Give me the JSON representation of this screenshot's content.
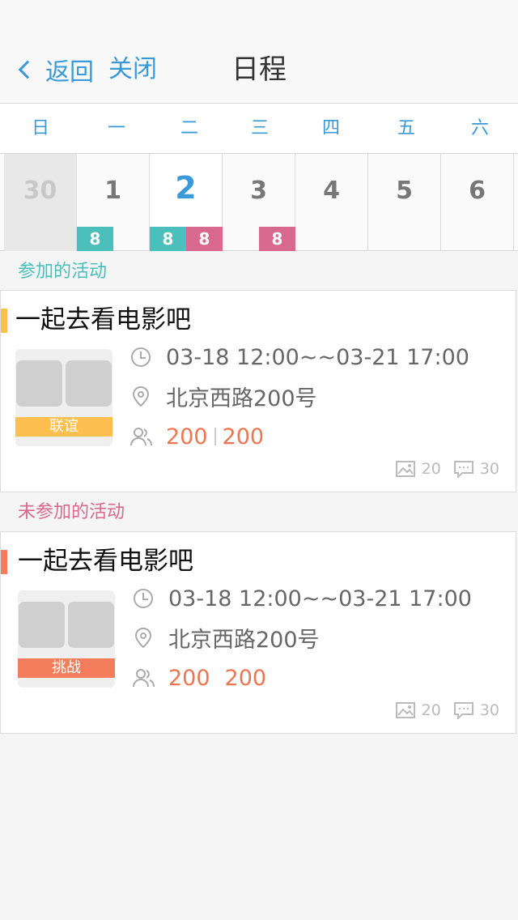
{
  "nav": {
    "back_label": "返回",
    "close_label": "关闭",
    "title": "日程"
  },
  "calendar": {
    "weekdays": [
      "日",
      "一",
      "二",
      "三",
      "四",
      "五",
      "六"
    ],
    "days": [
      "30",
      "1",
      "2",
      "3",
      "4",
      "5",
      "6"
    ],
    "badges": {
      "mon_teal": "8",
      "tue_teal": "8",
      "tue_pink": "8",
      "wed_pink": "8"
    },
    "colors": {
      "teal": "#4bbfbb",
      "pink": "#d9688f",
      "accent": "#3a9ad9"
    }
  },
  "sections": {
    "joined_title": "参加的活动",
    "unjoined_title": "未参加的活动"
  },
  "joined": {
    "title": "一起去看电影吧",
    "tag": "联谊",
    "tag_color": "#ffbf50",
    "time": "03-18  12:00~~03-21  17:00",
    "location": "北京西路200号",
    "count_current": "200",
    "count_max": "200",
    "photos": "20",
    "comments": "30"
  },
  "unjoined": {
    "title": "一起去看电影吧",
    "tag": "挑战",
    "tag_color": "#f47d5d",
    "time": "03-18  12:00~~03-21  17:00",
    "location": "北京西路200号",
    "count_current": "200",
    "count_max": "200",
    "photos": "20",
    "comments": "30"
  },
  "icons": [
    "chevron-left-icon",
    "clock-icon",
    "location-pin-icon",
    "people-icon",
    "image-icon",
    "comment-icon"
  ]
}
